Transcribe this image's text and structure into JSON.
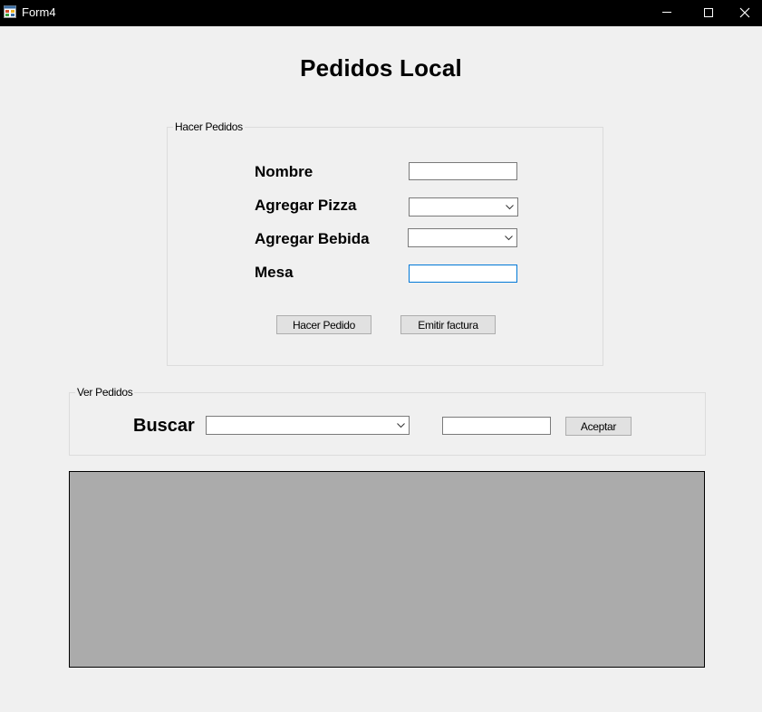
{
  "window": {
    "title": "Form4",
    "app_icon": "winforms-app-icon",
    "controls": [
      "minimize-icon",
      "maximize-icon",
      "close-icon"
    ]
  },
  "page": {
    "title": "Pedidos Local"
  },
  "hacer_pedidos": {
    "legend": "Hacer Pedidos",
    "fields": {
      "nombre": {
        "label": "Nombre",
        "value": ""
      },
      "pizza": {
        "label": "Agregar Pizza",
        "value": ""
      },
      "bebida": {
        "label": "Agregar Bebida",
        "value": ""
      },
      "mesa": {
        "label": "Mesa",
        "value": ""
      }
    },
    "buttons": {
      "hacer_pedido": "Hacer Pedido",
      "emitir_factura": "Emitir factura"
    }
  },
  "ver_pedidos": {
    "legend": "Ver Pedidos",
    "buscar_label": "Buscar",
    "buscar_value": "",
    "search_value": "",
    "aceptar": "Aceptar"
  },
  "colors": {
    "background": "#f0f0f0",
    "titlebar": "#000000",
    "grid_background": "#ababab",
    "focus_border": "#0078d7"
  }
}
